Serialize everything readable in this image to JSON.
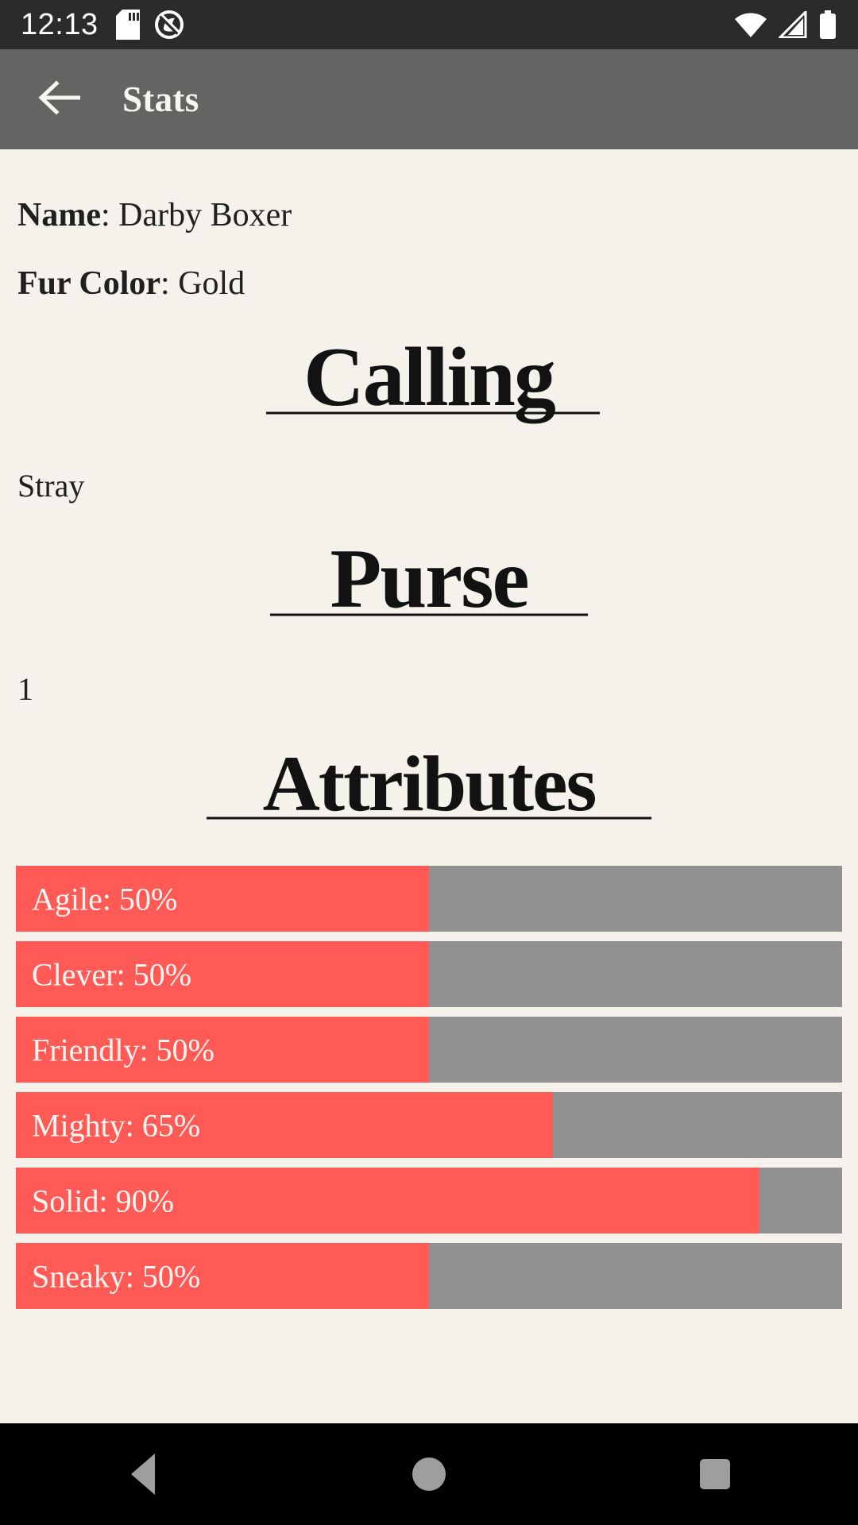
{
  "status_bar": {
    "time": "12:13",
    "icons": [
      "sd-card-icon",
      "dnd-icon",
      "wifi-icon",
      "cellular-signal-icon",
      "battery-icon"
    ]
  },
  "app_bar": {
    "back_icon": "back-arrow-icon",
    "title": "Stats"
  },
  "info": {
    "name_label": "Name",
    "name_sep": ": ",
    "name_value": "Darby Boxer",
    "fur_label": "Fur Color",
    "fur_sep": ": ",
    "fur_value": "Gold"
  },
  "sections": [
    {
      "heading": "Calling",
      "value": "Stray"
    },
    {
      "heading": "Purse",
      "value": "1"
    }
  ],
  "attributes_heading": "Attributes",
  "attributes": [
    {
      "name": "Agile",
      "percent": 50,
      "label": "Agile: 50%"
    },
    {
      "name": "Clever",
      "percent": 50,
      "label": "Clever: 50%"
    },
    {
      "name": "Friendly",
      "percent": 50,
      "label": "Friendly: 50%"
    },
    {
      "name": "Mighty",
      "percent": 65,
      "label": "Mighty: 65%"
    },
    {
      "name": "Solid",
      "percent": 90,
      "label": "Solid: 90%"
    },
    {
      "name": "Sneaky",
      "percent": 50,
      "label": "Sneaky: 50%"
    }
  ],
  "colors": {
    "background": "#f5f2ec",
    "app_bar": "#666462",
    "status_bar": "#2b2b2b",
    "bar_fill": "#ff5a55",
    "bar_track": "#919191",
    "text": "#1f1f1f"
  },
  "nav_bar": {
    "back": "nav-back-icon",
    "home": "nav-home-icon",
    "recents": "nav-recents-icon"
  }
}
